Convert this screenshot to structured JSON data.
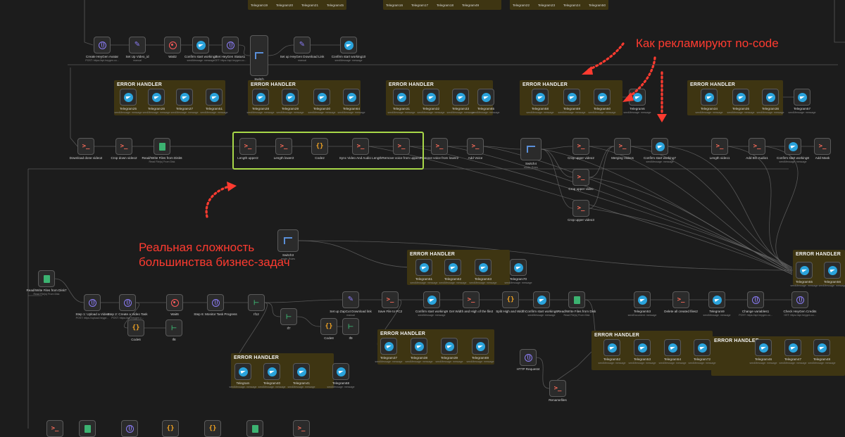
{
  "annotations": {
    "hype": "Как рекламируют no-code",
    "reality_line1": "Реальная сложность",
    "reality_line2": "большинства бизнес-задач",
    "color": "#ff3b30"
  },
  "group_title": "ERROR HANDLER",
  "top_partial_nodes": {
    "a": [
      "Telegram19",
      "Telegram20",
      "Telegram21",
      "Telegram45"
    ],
    "b": [
      "Telegram16",
      "Telegram17",
      "Telegram18",
      "Telegram49"
    ],
    "c": [
      "Telegram22",
      "Telegram23",
      "Telegram24",
      "Telegram50"
    ]
  },
  "nodes": {
    "create_heygen_avatar": {
      "label": "Create HeyGen Avatar",
      "sub": "POST: https://api.heygen.co..."
    },
    "set_up_video_id": {
      "label": "Set Up Video_id",
      "sub": "manual"
    },
    "wait2": {
      "label": "Wait2",
      "sub": ""
    },
    "confirm_start_working2": {
      "label": "Confirm start working2",
      "sub": "sendMessage: message"
    },
    "get_heygen_status1": {
      "label": "Get HeyGen Status1",
      "sub": "GET: https://api.heygen.co..."
    },
    "switch": {
      "label": "Switch",
      "sub": "mode: Rules"
    },
    "set_up_heygen_download_link": {
      "label": "Set up HeyGen Download Link",
      "sub": "manual"
    },
    "confirm_start_working10": {
      "label": "Confirm start working10",
      "sub": "sendMessage: message"
    },
    "telegram25": {
      "label": "Telegram25",
      "sub": "sendMessage: message"
    },
    "telegram26": {
      "label": "Telegram26",
      "sub": "sendMessage: message"
    },
    "telegram27": {
      "label": "Telegram27",
      "sub": "sendMessage: message"
    },
    "telegram51": {
      "label": "Telegram51",
      "sub": "sendMessage: message"
    },
    "telegram28": {
      "label": "Telegram28",
      "sub": "sendMessage: message"
    },
    "telegram29": {
      "label": "Telegram29",
      "sub": "sendMessage: message"
    },
    "telegram30": {
      "label": "Telegram30",
      "sub": "sendMessage: message"
    },
    "telegram64": {
      "label": "Telegram64",
      "sub": "sendMessage: message"
    },
    "telegram31": {
      "label": "Telegram31",
      "sub": "sendMessage: message"
    },
    "telegram32": {
      "label": "Telegram32",
      "sub": "sendMessage: message"
    },
    "telegram33": {
      "label": "Telegram33",
      "sub": "sendMessage: message"
    },
    "telegram65": {
      "label": "Telegram65",
      "sub": "sendMessage: message"
    },
    "telegram58": {
      "label": "Telegram58",
      "sub": "sendMessage: message"
    },
    "telegram59": {
      "label": "Telegram59",
      "sub": "sendMessage: message"
    },
    "telegram60": {
      "label": "Telegram60",
      "sub": "sendMessage: message"
    },
    "telegram6": {
      "label": "Telegram6",
      "sub": "sendMessage: message"
    },
    "telegram34": {
      "label": "Telegram34",
      "sub": "sendMessage: message"
    },
    "telegram35": {
      "label": "Telegram35",
      "sub": "sendMessage: message"
    },
    "telegram36": {
      "label": "Telegram36",
      "sub": "sendMessage: message"
    },
    "telegram57": {
      "label": "Telegram57",
      "sub": "sendMessage: message"
    },
    "download_done_video2": {
      "label": "Download done video2",
      "sub": ""
    },
    "crop_down_video2": {
      "label": "Crop down video2",
      "sub": ""
    },
    "read_write_files_from_disk6": {
      "label": "Read/Write Files from Disk6",
      "sub": "Read File(s) From Disk"
    },
    "length_upper2": {
      "label": "Length upper2",
      "sub": ""
    },
    "length_lower2": {
      "label": "Length lower2",
      "sub": ""
    },
    "code2": {
      "label": "Code2",
      "sub": ""
    },
    "sync_video_and_audio_length": {
      "label": "Sync Video And Audio Length",
      "sub": ""
    },
    "remove_voice_from_upper2": {
      "label": "Remove voice from upper2",
      "sub": ""
    },
    "remove_voice_from_lower2": {
      "label": "Remove voice from lower2",
      "sub": ""
    },
    "add_voice": {
      "label": "Add Voice",
      "sub": ""
    },
    "switch4": {
      "label": "Switch4",
      "sub": "mode: Rules"
    },
    "crop_upper_video2": {
      "label": "Crop upper video2",
      "sub": ""
    },
    "merging_videos": {
      "label": "Merging Videos",
      "sub": ""
    },
    "confirm_start_working7": {
      "label": "Confirm start working7",
      "sub": "sendMessage: message"
    },
    "length_video1": {
      "label": "Length video1",
      "sub": ""
    },
    "add_bg_audio1": {
      "label": "Add BG Audio1",
      "sub": ""
    },
    "confirm_start_working8": {
      "label": "Confirm start working8",
      "sub": "sendMessage: message"
    },
    "add_mask": {
      "label": "Add Mask",
      "sub": ""
    },
    "crop_upper_video": {
      "label": "Crop upper video",
      "sub": ""
    },
    "crop_upper_video3": {
      "label": "Crop upper video3",
      "sub": ""
    },
    "switch3": {
      "label": "Switch3",
      "sub": "mode: Rules"
    },
    "telegram61": {
      "label": "Telegram61",
      "sub": "sendMessage: message"
    },
    "telegram62": {
      "label": "Telegram62",
      "sub": "sendMessage: message"
    },
    "telegram63": {
      "label": "Telegram63",
      "sub": "sendMessage: message"
    },
    "telegram70": {
      "label": "Telegram70",
      "sub": "sendMessage: message"
    },
    "telegram55": {
      "label": "Telegram55",
      "sub": "sendMessage: message"
    },
    "telegram56": {
      "label": "Telegram56",
      "sub": "sendMessage: message"
    },
    "read_write_files_from_disk7": {
      "label": "Read/Write Files from Disk7",
      "sub": "Read File(s) From Disk"
    },
    "step1_upload_video": {
      "label": "Step 1: Upload a Video",
      "sub": "POST: https://upload.heyge..."
    },
    "step2_create_video_task": {
      "label": "Step 2: Create a Video Task",
      "sub": "POST: https://api.heygen.c..."
    },
    "wait6": {
      "label": "Wait6",
      "sub": ""
    },
    "step6_monitor_task_progress": {
      "label": "Step 6: Monitor Task Progress",
      "sub": ""
    },
    "if12": {
      "label": "If12",
      "sub": ""
    },
    "if7": {
      "label": "If7",
      "sub": ""
    },
    "code6": {
      "label": "Code6",
      "sub": ""
    },
    "if8": {
      "label": "If8",
      "sub": ""
    },
    "code8": {
      "label": "Code8",
      "sub": ""
    },
    "if9": {
      "label": "If9",
      "sub": ""
    },
    "set_up_zapcut_download_link": {
      "label": "Set up ZapCut Download link",
      "sub": "manual"
    },
    "save_file_to_pc2": {
      "label": "Save File to PC2",
      "sub": ""
    },
    "confirm_start_working9": {
      "label": "Confirm start working9",
      "sub": "sendMessage: message"
    },
    "get_width_and_high_of_the_file2": {
      "label": "Get Width and High of the file2",
      "sub": ""
    },
    "split_high_and_width": {
      "label": "Split High and Width",
      "sub": ""
    },
    "confirm_start_working6": {
      "label": "Confirm start working6",
      "sub": "sendMessage: message"
    },
    "read_write_files_from_disk": {
      "label": "Read/Write Files from Disk",
      "sub": "Read File(s) From Disk"
    },
    "telegram53": {
      "label": "Telegram53",
      "sub": "sendDocument: message"
    },
    "delete_all_created_files2": {
      "label": "Delete all created files2",
      "sub": ""
    },
    "telegram9": {
      "label": "Telegram9",
      "sub": "sendMessage: message"
    },
    "change_variables1": {
      "label": "Change variables1",
      "sub": "POST: https://api.heygen.co..."
    },
    "check_heygen_credits": {
      "label": "Check HeyGen Credits",
      "sub": "GET: https://api.heygen.co..."
    },
    "telegram37": {
      "label": "Telegram37",
      "sub": "sendMessage: message"
    },
    "telegram38": {
      "label": "Telegram38",
      "sub": "sendMessage: message"
    },
    "telegram39": {
      "label": "Telegram39",
      "sub": "sendMessage: message"
    },
    "telegram69": {
      "label": "Telegram69",
      "sub": "sendMessage: message"
    },
    "telegram": {
      "label": "Telegram",
      "sub": "sendMessage: message"
    },
    "telegram40": {
      "label": "Telegram40",
      "sub": "sendMessage: message"
    },
    "telegram41": {
      "label": "Telegram41",
      "sub": "sendMessage: message"
    },
    "telegram68": {
      "label": "Telegram68",
      "sub": "sendMessage: message"
    },
    "http_request4": {
      "label": "HTTP Request4",
      "sub": ""
    },
    "rename_files": {
      "label": "Renamefiles",
      "sub": ""
    },
    "telegram52": {
      "label": "Telegram52",
      "sub": "sendMessage: message"
    },
    "telegram53b": {
      "label": "Telegram53",
      "sub": "sendMessage: message"
    },
    "telegram54": {
      "label": "Telegram54",
      "sub": "sendMessage: message"
    },
    "telegram72": {
      "label": "Telegram72",
      "sub": "sendMessage: message"
    },
    "telegram46": {
      "label": "Telegram46",
      "sub": "sendMessage: message"
    },
    "telegram47": {
      "label": "Telegram47",
      "sub": "sendMessage: message"
    },
    "telegram48": {
      "label": "Telegram48",
      "sub": "sendMessage: message"
    }
  },
  "colors": {
    "canvas": "#1c1c1c",
    "group_fill": "#3e3512",
    "highlight_border": "#a8d848",
    "telegram": "#2aa3dc",
    "execute_command": "#ff6d5a",
    "code": "#f5a623",
    "http": "#8b7cf6",
    "files": "#3cb371"
  }
}
